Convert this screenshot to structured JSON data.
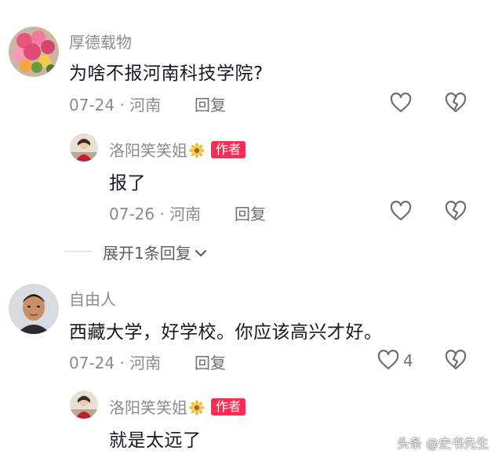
{
  "comments": [
    {
      "username": "厚德载物",
      "text": "为啥不报河南科技学院?",
      "date_location": "07-24 · 河南",
      "reply_label": "回复",
      "like_icon": "heart-outline-icon",
      "dislike_icon": "broken-heart-icon",
      "replies": [
        {
          "username": "洛阳笑笑姐",
          "badge": "作者",
          "text": "报了",
          "date_location": "07-26 · 河南",
          "reply_label": "回复"
        }
      ],
      "expand_label": "展开1条回复"
    },
    {
      "username": "自由人",
      "text": "西藏大学，好学校。你应该高兴才好。",
      "date_location": "07-24 · 河南",
      "reply_label": "回复",
      "like_count": "4",
      "replies": [
        {
          "username": "洛阳笑笑姐",
          "badge": "作者",
          "text": "就是太远了"
        }
      ]
    }
  ],
  "watermark": "头条 @史书先生",
  "colors": {
    "badge": "#fe2c55",
    "secondary_text": "#8a8b91",
    "primary_text": "#161823"
  }
}
